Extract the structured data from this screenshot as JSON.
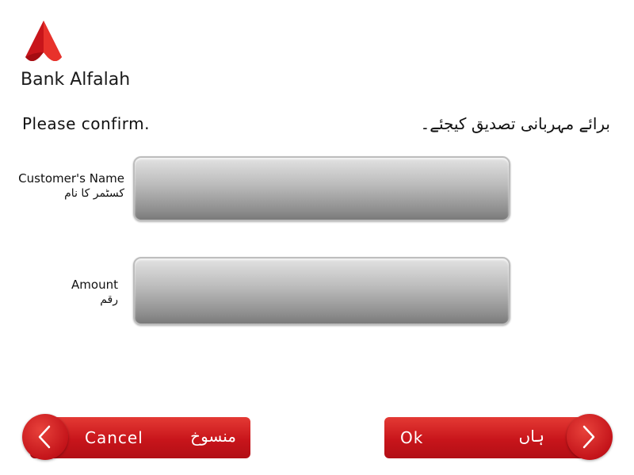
{
  "brand": {
    "name": "Bank Alfalah",
    "color": "#d71920"
  },
  "prompt": {
    "english": "Please confirm.",
    "urdu": "برائے مہربانی تصدیق کیجئے۔"
  },
  "fields": [
    {
      "label_en": "Customer's Name",
      "label_ur": "کسٹمر کا نام",
      "value": ""
    },
    {
      "label_en": "Amount",
      "label_ur": "رقم",
      "value": ""
    }
  ],
  "buttons": {
    "cancel": {
      "label_en": "Cancel",
      "label_ur": "منسوخ",
      "icon": "chevron-left-icon"
    },
    "ok": {
      "label_en": "Ok",
      "label_ur": "ہاں",
      "icon": "chevron-right-icon"
    }
  }
}
